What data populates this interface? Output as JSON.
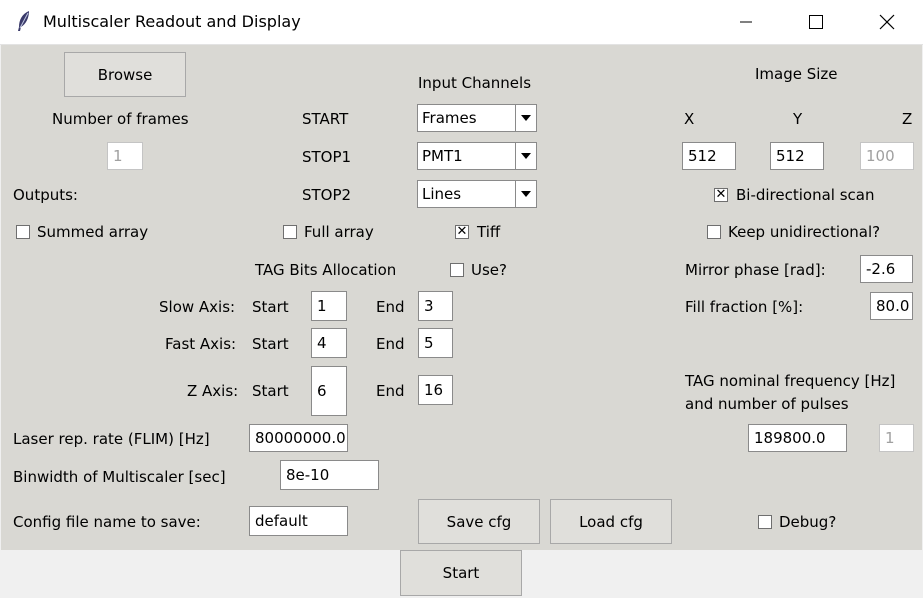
{
  "window": {
    "title": "Multiscaler Readout and Display"
  },
  "buttons": {
    "browse": "Browse",
    "save_cfg": "Save cfg",
    "load_cfg": "Load cfg",
    "start": "Start"
  },
  "input_channels": {
    "heading": "Input Channels",
    "start_label": "START",
    "start_value": "Frames",
    "stop1_label": "STOP1",
    "stop1_value": "PMT1",
    "stop2_label": "STOP2",
    "stop2_value": "Lines"
  },
  "frames": {
    "label": "Number of frames",
    "value": "1"
  },
  "image_size": {
    "heading": "Image Size",
    "x_label": "X",
    "y_label": "Y",
    "z_label": "Z",
    "x_value": "512",
    "y_value": "512",
    "z_value": "100"
  },
  "outputs": {
    "label": "Outputs:",
    "summed": "Summed array",
    "full": "Full array",
    "tiff": "Tiff",
    "summed_checked": false,
    "full_checked": false,
    "tiff_checked": true
  },
  "scan": {
    "bidirectional": "Bi-directional scan",
    "bidirectional_checked": true,
    "keep_unidirectional": "Keep unidirectional?",
    "keep_checked": false,
    "mirror_phase_label": "Mirror phase [rad]:",
    "mirror_phase_value": "-2.6",
    "fill_fraction_label": "Fill fraction [%]:",
    "fill_fraction_value": "80.0"
  },
  "tag_bits": {
    "heading": "TAG Bits Allocation",
    "use_label": "Use?",
    "use_checked": false,
    "start_word": "Start",
    "end_word": "End",
    "slow_label": "Slow Axis:",
    "slow_start": "1",
    "slow_end": "3",
    "fast_label": "Fast Axis:",
    "fast_start": "4",
    "fast_end": "5",
    "z_label": "Z Axis:",
    "z_start": "6",
    "z_end": "16"
  },
  "tag_freq": {
    "line1": "TAG nominal frequency [Hz]",
    "line2": "and number of pulses",
    "freq_value": "189800.0",
    "pulses_value": "1"
  },
  "laser": {
    "label": "Laser rep. rate (FLIM) [Hz]",
    "value": "80000000.0"
  },
  "binwidth": {
    "label": "Binwidth of Multiscaler [sec]",
    "value": "8e-10"
  },
  "config": {
    "label": "Config file name to save:",
    "value": "default"
  },
  "debug": {
    "label": "Debug?",
    "checked": false
  }
}
